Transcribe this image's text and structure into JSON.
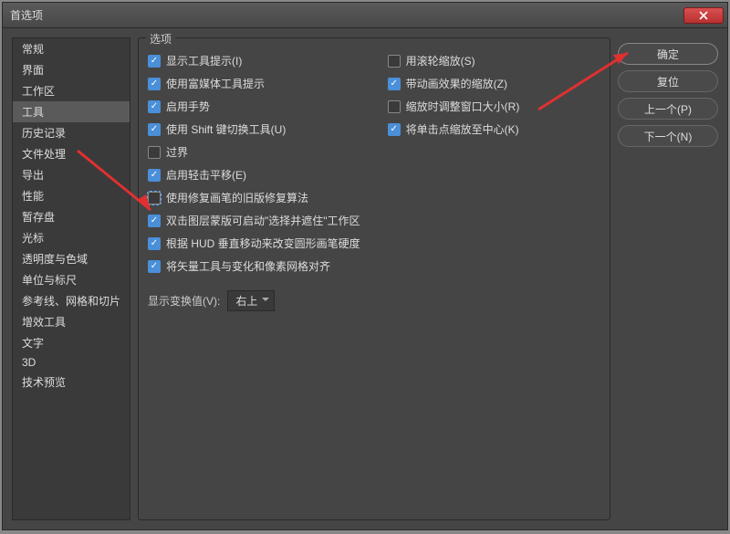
{
  "window": {
    "title": "首选项"
  },
  "sidebar": {
    "items": [
      "常规",
      "界面",
      "工作区",
      "工具",
      "历史记录",
      "文件处理",
      "导出",
      "性能",
      "暂存盘",
      "光标",
      "透明度与色域",
      "单位与标尺",
      "参考线、网格和切片",
      "增效工具",
      "文字",
      "3D",
      "技术预览"
    ],
    "active_index": 3
  },
  "panel": {
    "title": "选项",
    "left_column": [
      {
        "label": "显示工具提示(I)",
        "checked": true
      },
      {
        "label": "使用富媒体工具提示",
        "checked": true
      },
      {
        "label": "启用手势",
        "checked": true
      },
      {
        "label": "使用 Shift 键切换工具(U)",
        "checked": true
      },
      {
        "label": "过界",
        "checked": false
      },
      {
        "label": "启用轻击平移(E)",
        "checked": true
      },
      {
        "label": "使用修复画笔的旧版修复算法",
        "checked": false,
        "highlight": true
      },
      {
        "label": "双击图层蒙版可启动\"选择并遮住\"工作区",
        "checked": true
      },
      {
        "label": "根据 HUD 垂直移动来改变圆形画笔硬度",
        "checked": true
      },
      {
        "label": "将矢量工具与变化和像素网格对齐",
        "checked": true
      }
    ],
    "right_column": [
      {
        "label": "用滚轮缩放(S)",
        "checked": false
      },
      {
        "label": "带动画效果的缩放(Z)",
        "checked": true
      },
      {
        "label": "缩放时调整窗口大小(R)",
        "checked": false
      },
      {
        "label": "将单击点缩放至中心(K)",
        "checked": true
      }
    ],
    "dropdown": {
      "label": "显示变换值(V):",
      "value": "右上"
    }
  },
  "buttons": {
    "ok": "确定",
    "reset": "复位",
    "prev": "上一个(P)",
    "next": "下一个(N)"
  }
}
